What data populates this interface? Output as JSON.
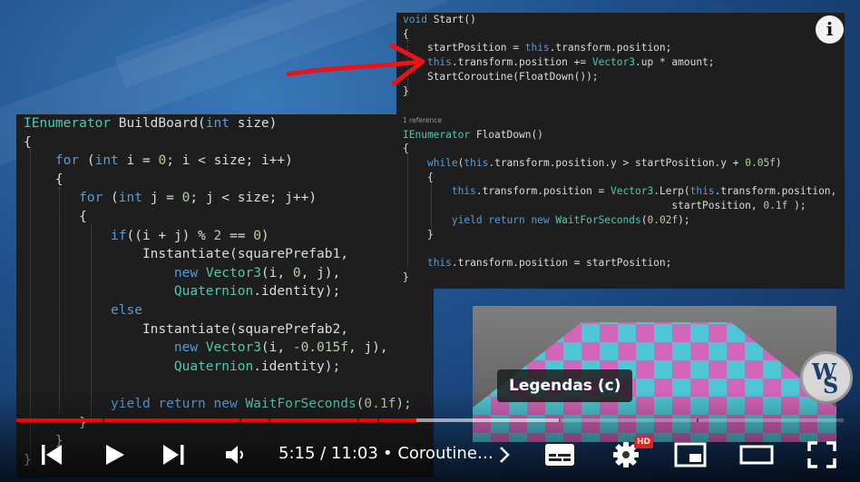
{
  "code_left": {
    "lines": [
      "<span class=\"ty\">IEnumerator</span> BuildBoard(<span class=\"kw\">int</span> size)",
      "{",
      "    <span class=\"kw\">for</span> (<span class=\"kw\">int</span> i = <span class=\"nm\">0</span>; i &lt; size; i++)",
      "    {",
      "       <span class=\"kw\">for</span> (<span class=\"kw\">int</span> j = <span class=\"nm\">0</span>; j &lt; size; j++)",
      "       {",
      "           <span class=\"kw\">if</span>((i + j) % <span class=\"nm\">2</span> == <span class=\"nm\">0</span>)",
      "               Instantiate(squarePrefab1,",
      "                   <span class=\"kw\">new</span> <span class=\"ty\">Vector3</span>(i, <span class=\"nm\">0</span>, j),",
      "                   <span class=\"ty\">Quaternion</span>.identity);",
      "           <span class=\"kw\">else</span>",
      "               Instantiate(squarePrefab2,",
      "                   <span class=\"kw\">new</span> <span class=\"ty\">Vector3</span>(i, <span class=\"nm\">-0.015f</span>, j),",
      "                   <span class=\"ty\">Quaternion</span>.identity);",
      "",
      "           <span class=\"kw\">yield return new</span> <span class=\"ty\">WaitForSeconds</span>(<span class=\"nm\">0.1f</span>);",
      "       }",
      "    }",
      "}"
    ]
  },
  "code_top": {
    "lines": [
      "<span class=\"kw\">void</span> Start()",
      "{",
      "    startPosition = <span class=\"kw\">this</span>.transform.position;",
      "    <span class=\"kw\">this</span>.transform.position += <span class=\"ty\">Vector3</span>.up * amount;",
      "    StartCoroutine(FloatDown());",
      "}",
      "",
      "<span class=\"ref\">1 reference</span>",
      "<span class=\"ty\">IEnumerator</span> FloatDown()",
      "{",
      "    <span class=\"kw\">while</span>(<span class=\"kw\">this</span>.transform.position.y &gt; startPosition.y + <span class=\"nm\">0.05f</span>)",
      "    {",
      "        <span class=\"kw\">this</span>.transform.position = <span class=\"ty\">Vector3</span>.Lerp(<span class=\"kw\">this</span>.transform.position,",
      "                                            startPosition, <span class=\"nm\">0.1f</span> );",
      "        <span class=\"kw\">yield return new</span> <span class=\"ty\">WaitForSeconds</span>(<span class=\"nm\">0.02f</span>);",
      "    }",
      "",
      "    <span class=\"kw\">this</span>.transform.position = startPosition;",
      "}"
    ]
  },
  "overlay": {
    "info_icon": "info-icon",
    "info_glyph": "i",
    "caption_text": "Legendas (c)",
    "logo_letters": [
      "W",
      "S"
    ],
    "arrow_color": "#e8141a"
  },
  "player": {
    "time_current": "5:15",
    "time_total": "11:03",
    "time_display": "5:15 / 11:03",
    "chapter_text": "• Coroutine…",
    "hd_badge": "HD",
    "progress_played": 0.484,
    "icons": [
      "skip-previous-icon",
      "play-icon",
      "skip-next-icon",
      "volume-icon",
      "chevron-right-icon",
      "subtitles-icon",
      "settings-icon",
      "miniplayer-icon",
      "theater-mode-icon",
      "fullscreen-icon"
    ],
    "colors": {
      "played": "#ff0000",
      "hd": "#e62117"
    }
  }
}
